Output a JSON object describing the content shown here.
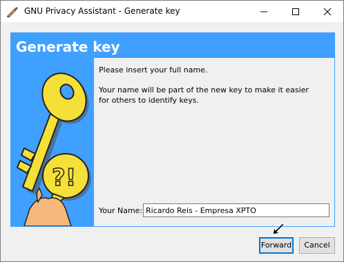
{
  "window": {
    "title": "GNU Privacy Assistant - Generate key",
    "app_icon": "pen-icon",
    "controls": [
      "minimize-icon",
      "maximize-icon",
      "close-icon"
    ]
  },
  "header": {
    "title": "Generate key",
    "background_color": "#40a0ff"
  },
  "illustration": {
    "icon": "key-question-icon"
  },
  "panel": {
    "line1": "Please insert your full name.",
    "line2": "Your name will be part of the new key to make it easier",
    "line3": "for others to identify keys."
  },
  "name_field": {
    "label": "Your Name:",
    "value": "Ricardo Reis - Empresa XPTO"
  },
  "buttons": {
    "forward": "Forward",
    "cancel": "Cancel"
  },
  "cursor": "arrow-cursor-icon"
}
